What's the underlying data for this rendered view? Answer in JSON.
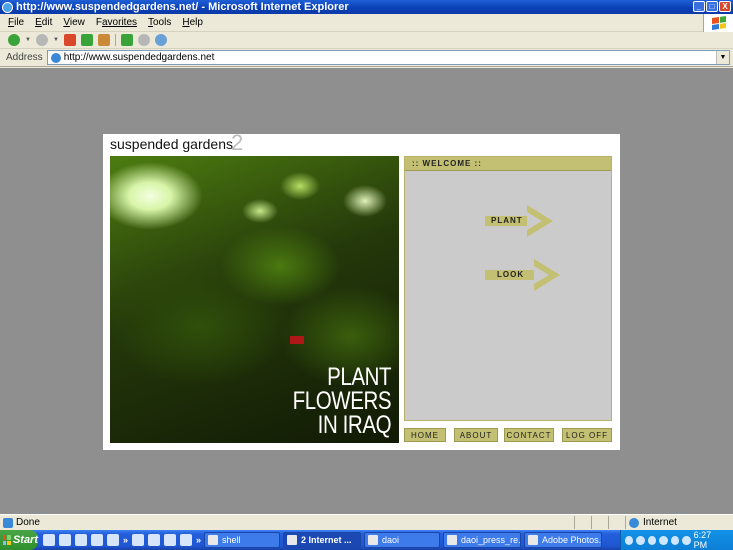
{
  "window": {
    "title": "http://www.suspendedgardens.net/ - Microsoft Internet Explorer",
    "buttons": [
      "_",
      "□",
      "X"
    ]
  },
  "menu": [
    {
      "label": "File",
      "key": "F",
      "rest": "ile"
    },
    {
      "label": "Edit",
      "key": "E",
      "rest": "dit"
    },
    {
      "label": "View",
      "key": "V",
      "rest": "iew"
    },
    {
      "label": "Favorites",
      "key": "F",
      "rest": "avorites"
    },
    {
      "label": "Tools",
      "key": "T",
      "rest": "ools"
    },
    {
      "label": "Help",
      "key": "H",
      "rest": "elp"
    }
  ],
  "address": {
    "label": "Address",
    "url": "http://www.suspendedgardens.net"
  },
  "site": {
    "title": "suspended gardens",
    "title_number": "2",
    "photo_text": [
      "PLANT",
      "FLOWERS",
      "IN IRAQ"
    ],
    "panel_header": ":: WELCOME ::",
    "actions": [
      "PLANT",
      "LOOK"
    ],
    "nav": [
      "HOME",
      "ABOUT",
      "CONTACT",
      "LOG OFF"
    ]
  },
  "status": {
    "text": "Done",
    "zone": "Internet"
  },
  "taskbar": {
    "start": "Start",
    "quick_launch_chevron": "»",
    "tasks": [
      {
        "label": "shell",
        "active": false
      },
      {
        "label": "2 Internet ...",
        "active": true
      },
      {
        "label": "daoi",
        "active": false
      },
      {
        "label": "daoi_press_re...",
        "active": false
      },
      {
        "label": "Adobe Photos...",
        "active": false
      }
    ],
    "clock": "6:27 PM"
  },
  "colors": {
    "panel_bg": "#cbcbcb",
    "accent_olive": "#c3c073",
    "page_bg": "#8f8f8f"
  }
}
